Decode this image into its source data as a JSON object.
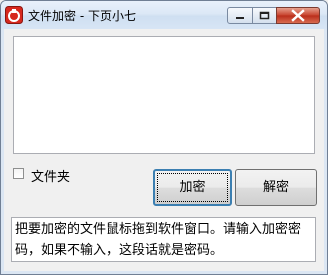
{
  "window": {
    "title": "文件加密 - 下页小七",
    "app_icon": "red-lock-icon",
    "controls": {
      "minimize_icon": "minimize-icon",
      "maximize_icon": "maximize-icon",
      "close_icon": "close-icon"
    }
  },
  "main": {
    "folder_checkbox": {
      "label": "文件夹",
      "checked": false
    },
    "encrypt_button": {
      "label": "加密"
    },
    "decrypt_button": {
      "label": "解密"
    },
    "password_box": {
      "text": "把要加密的文件鼠标拖到软件窗口。请输入加密密码，如果不输入，这段话就是密码。"
    }
  },
  "colors": {
    "close_button": "#c7412c",
    "focus_border": "#3c7fb1"
  }
}
